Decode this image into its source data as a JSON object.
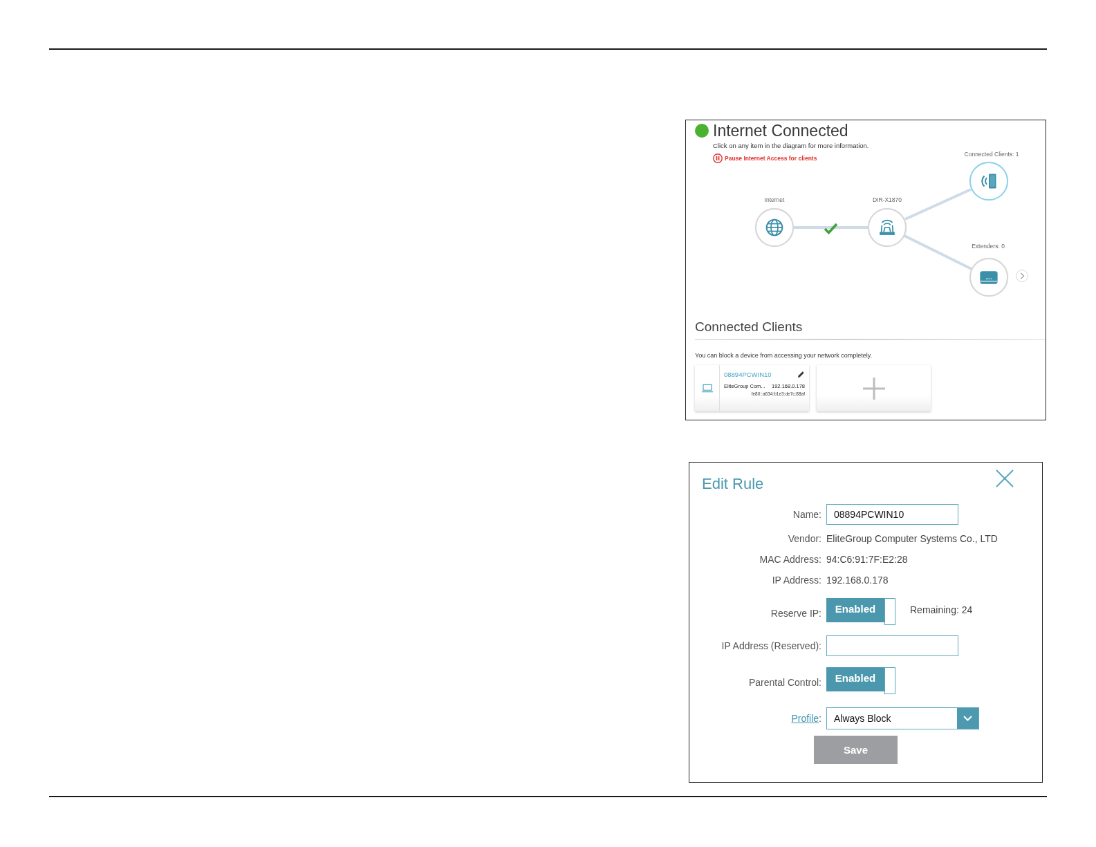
{
  "network_panel": {
    "status": {
      "title": "Internet Connected",
      "connected": true
    },
    "hint": "Click on any item in the diagram for more information.",
    "pause_link": "Pause Internet Access for clients",
    "diagram": {
      "nodes": [
        {
          "kind": "internet",
          "label": "Internet",
          "selected": false
        },
        {
          "kind": "router",
          "label": "DIR-X1870",
          "selected": false
        },
        {
          "kind": "clients",
          "label": "Connected Clients: 1",
          "selected": true
        },
        {
          "kind": "extenders",
          "label": "Extenders: 0",
          "selected": false
        }
      ],
      "internet_link_ok": true
    },
    "clients_section": {
      "title": "Connected Clients",
      "note": "You can block a device from accessing your network completely.",
      "clients": [
        {
          "name": "08894PCWIN10",
          "vendor": "EliteGroup Com...",
          "ip": "192.168.0.178",
          "ipv6": "fe80::a634:b1e3:de7c:88af"
        }
      ]
    }
  },
  "edit_rule": {
    "title": "Edit Rule",
    "fields": [
      {
        "kind": "input",
        "label": "Name:",
        "value": "08894PCWIN10"
      },
      {
        "kind": "text",
        "label": "Vendor:",
        "value": "EliteGroup Computer Systems Co., LTD"
      },
      {
        "kind": "text",
        "label": "MAC Address:",
        "value": "94:C6:91:7F:E2:28"
      },
      {
        "kind": "text",
        "label": "IP Address:",
        "value": "192.168.0.178"
      },
      {
        "kind": "toggle",
        "label": "Reserve IP:",
        "state_text": "Enabled",
        "on": true,
        "note": "Remaining: 24"
      },
      {
        "kind": "input",
        "label": "IP Address (Reserved):"
      },
      {
        "kind": "toggle",
        "label": "Parental Control:",
        "state_text": "Enabled",
        "on": true
      },
      {
        "kind": "select",
        "label": "Profile",
        "label_link": true,
        "label_suffix": ":",
        "value": "Always Block"
      }
    ],
    "save_button": "Save"
  }
}
